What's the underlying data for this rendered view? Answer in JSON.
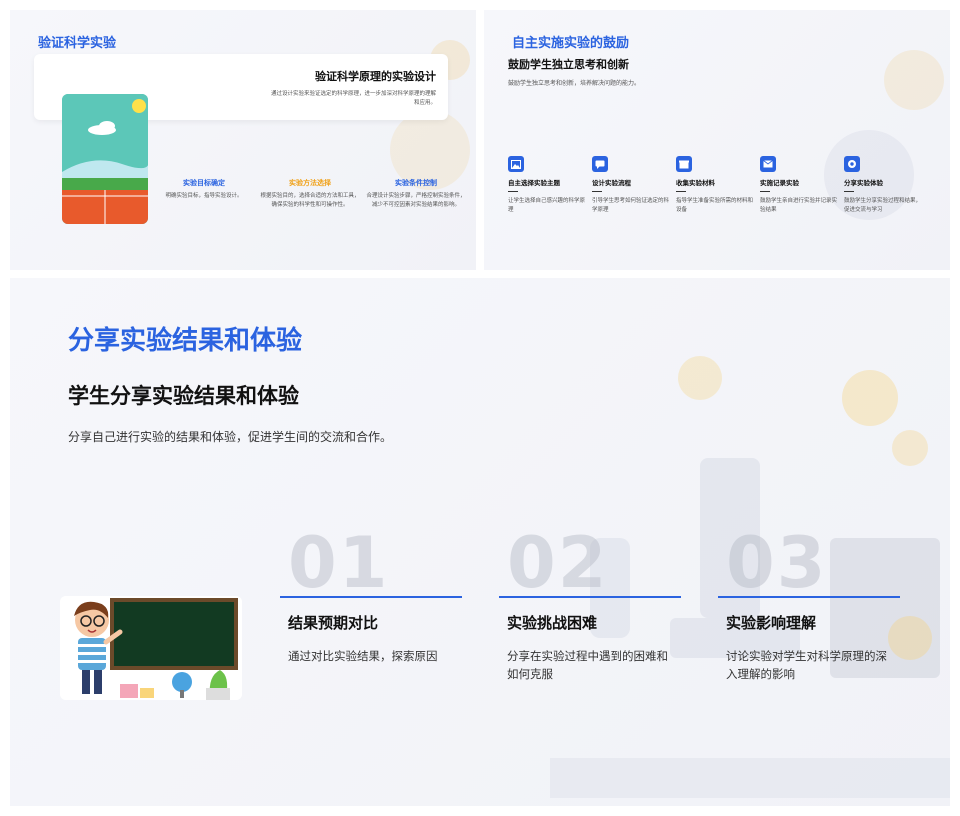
{
  "slide1": {
    "title": "验证科学实验",
    "card": {
      "heading": "验证科学原理的实验设计",
      "text": "通过设计实验来验证选定的科学原理，进一步加深对科学原理的理解和应用。"
    },
    "features": [
      {
        "title": "实验目标确定",
        "text": "明确实验目标，指导实验设计。",
        "color": "#2b63e0"
      },
      {
        "title": "实验方法选择",
        "text": "根据实验目的，选择合适的方法和工具，确保实验的科学性和可操作性。",
        "color": "#f0a21a"
      },
      {
        "title": "实验条件控制",
        "text": "合理设计实验步骤，严格控制实验条件，减少不可控因素对实验结果的影响。",
        "color": "#2b63e0"
      }
    ]
  },
  "slide2": {
    "title": "自主实施实验的鼓励",
    "subtitle": "鼓励学生独立思考和创新",
    "desc": "鼓励学生独立思考和创新，培养解决问题的能力。",
    "steps": [
      {
        "title": "自主选择实验主题",
        "text": "让学生选择自己感兴趣的科学原理",
        "icon": "image-icon"
      },
      {
        "title": "设计实验流程",
        "text": "引导学生思考如何验证选定的科学原理",
        "icon": "chat-icon"
      },
      {
        "title": "收集实验材料",
        "text": "指导学生准备实验所需的材料和设备",
        "icon": "box-icon"
      },
      {
        "title": "实施记录实验",
        "text": "鼓励学生亲自进行实验并记录实验结果",
        "icon": "mail-icon"
      },
      {
        "title": "分享实验体验",
        "text": "鼓励学生分享实验过程和结果，促进交流与学习",
        "icon": "target-icon"
      }
    ]
  },
  "slide3": {
    "title": "分享实验结果和体验",
    "subtitle": "学生分享实验结果和体验",
    "desc": "分享自己进行实验的结果和体验，促进学生间的交流和合作。",
    "columns": [
      {
        "num": "01",
        "title": "结果预期对比",
        "text": "通过对比实验结果，探索原因"
      },
      {
        "num": "02",
        "title": "实验挑战困难",
        "text": "分享在实验过程中遇到的困难和如何克服"
      },
      {
        "num": "03",
        "title": "实验影响理解",
        "text": "讨论实验对学生对科学原理的深入理解的影响"
      }
    ]
  },
  "colors": {
    "accent": "#2b63e0",
    "orange": "#f0a21a"
  }
}
